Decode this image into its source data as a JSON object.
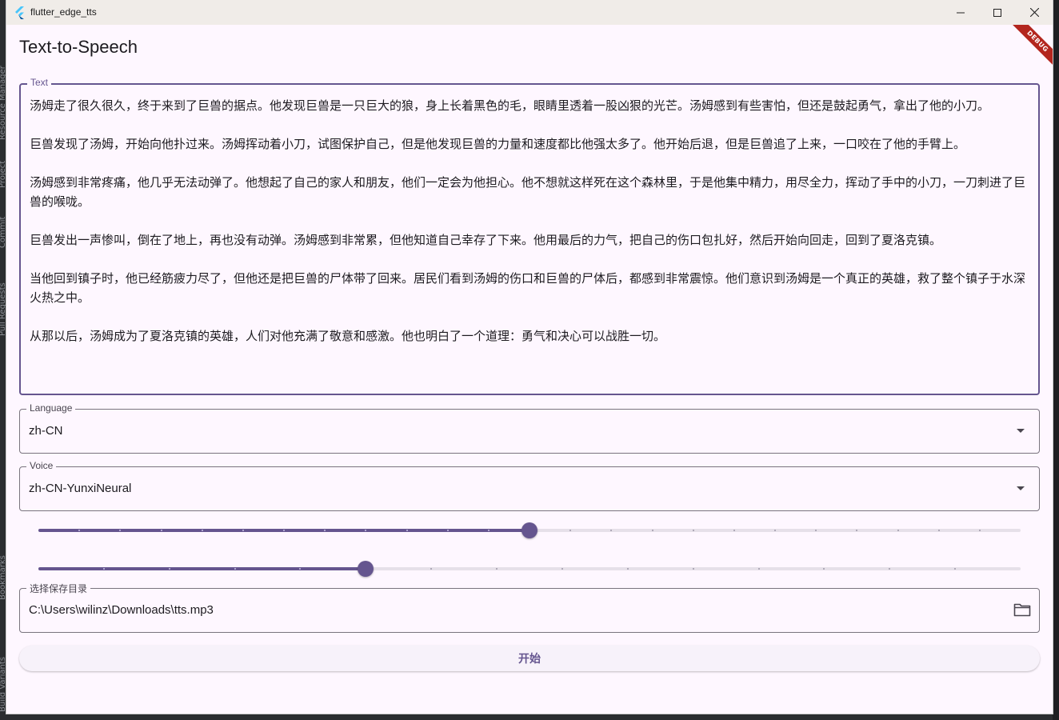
{
  "ide": {
    "left_labels": [
      "Resource Manager",
      "Project",
      "Commit",
      "Pull Requests",
      "Bookmarks",
      "Build Variants"
    ]
  },
  "window": {
    "title": "flutter_edge_tts",
    "minimize_icon": "minimize-icon",
    "maximize_icon": "maximize-icon",
    "close_icon": "close-icon"
  },
  "app_bar": {
    "title": "Text-to-Speech",
    "debug_banner": "DEBUG"
  },
  "text_field": {
    "label": "Text",
    "value": "汤姆走了很久很久，终于来到了巨兽的据点。他发现巨兽是一只巨大的狼，身上长着黑色的毛，眼睛里透着一股凶狠的光芒。汤姆感到有些害怕，但还是鼓起勇气，拿出了他的小刀。\n\n巨兽发现了汤姆，开始向他扑过来。汤姆挥动着小刀，试图保护自己，但是他发现巨兽的力量和速度都比他强太多了。他开始后退，但是巨兽追了上来，一口咬在了他的手臂上。\n\n汤姆感到非常疼痛，他几乎无法动弹了。他想起了自己的家人和朋友，他们一定会为他担心。他不想就这样死在这个森林里，于是他集中精力，用尽全力，挥动了手中的小刀，一刀刺进了巨兽的喉咙。\n\n巨兽发出一声惨叫，倒在了地上，再也没有动弹。汤姆感到非常累，但他知道自己幸存了下来。他用最后的力气，把自己的伤口包扎好，然后开始向回走，回到了夏洛克镇。\n\n当他回到镇子时，他已经筋疲力尽了，但他还是把巨兽的尸体带了回来。居民们看到汤姆的伤口和巨兽的尸体后，都感到非常震惊。他们意识到汤姆是一个真正的英雄，救了整个镇子于水深火热之中。\n\n从那以后，汤姆成为了夏洛克镇的英雄，人们对他充满了敬意和感激。他也明白了一个道理：勇气和决心可以战胜一切。"
  },
  "language": {
    "label": "Language",
    "value": "zh-CN",
    "icon": "dropdown-arrow-icon"
  },
  "voice": {
    "label": "Voice",
    "value": "zh-CN-YunxiNeural",
    "icon": "dropdown-arrow-icon"
  },
  "slider_1": {
    "divisions": 24,
    "value_fraction": 0.5
  },
  "slider_2": {
    "divisions": 15,
    "value_fraction": 0.3333
  },
  "save_path": {
    "label": "选择保存目录",
    "value": "C:\\Users\\wilinz\\Downloads\\tts.mp3",
    "icon": "folder-icon"
  },
  "start_button": {
    "label": "开始"
  },
  "colors": {
    "primary": "#65558f",
    "surface": "#fef7ff",
    "track_inactive": "#e6e0e9",
    "debug_banner": "#b3261e"
  }
}
